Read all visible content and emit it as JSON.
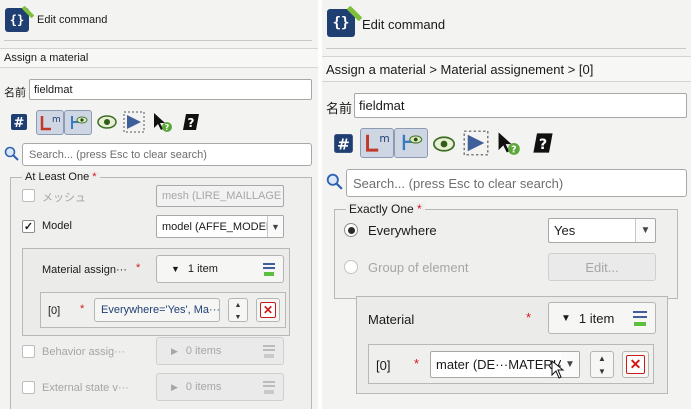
{
  "left": {
    "window_title": "Edit command",
    "path": "Assign a material",
    "name_label": "名前",
    "name_value": "fieldmat",
    "search_placeholder": "Search... (press Esc to clear search)",
    "group_title": "At Least One",
    "rows": [
      {
        "label": "メッシュ",
        "value": "mesh (LIRE_MAILLAGE",
        "checked": false,
        "enabled": false
      },
      {
        "label": "Model",
        "value": "model (AFFE_MODELE",
        "checked": true,
        "enabled": true
      }
    ],
    "material_label": "Material assign···",
    "material_count": "1 item",
    "item_index": "[0]",
    "item_value": "Everywhere='Yes', Ma···",
    "behavior_label": "Behavior assig···",
    "behavior_count": "0 items",
    "external_label": "External state v···",
    "external_count": "0 items"
  },
  "right": {
    "window_title": "Edit command",
    "path": "Assign a material > Material assignement > [0]",
    "name_label": "名前",
    "name_value": "fieldmat",
    "search_placeholder": "Search... (press Esc to clear search)",
    "group_title": "Exactly One",
    "everywhere_label": "Everywhere",
    "everywhere_value": "Yes",
    "group_element_label": "Group of element",
    "edit_label": "Edit...",
    "material_label": "Material",
    "material_count": "1 item",
    "item_index": "[0]",
    "item_value": "mater (DE···MATERIAU"
  },
  "required_mark": "*",
  "icons": [
    "edit-command-icon",
    "hash-icon",
    "link-icon",
    "tree-eye-icon",
    "eye-icon",
    "triangle-icon",
    "cursor-help-icon",
    "question-icon",
    "search-icon",
    "list-icon",
    "chevron-down-icon",
    "chevron-right-icon",
    "spin-up-icon",
    "spin-down-icon",
    "delete-icon"
  ],
  "colors": {
    "accent": "#1f3f73",
    "required": "#d21919",
    "selected_toolbar": "#cfd6e3"
  }
}
